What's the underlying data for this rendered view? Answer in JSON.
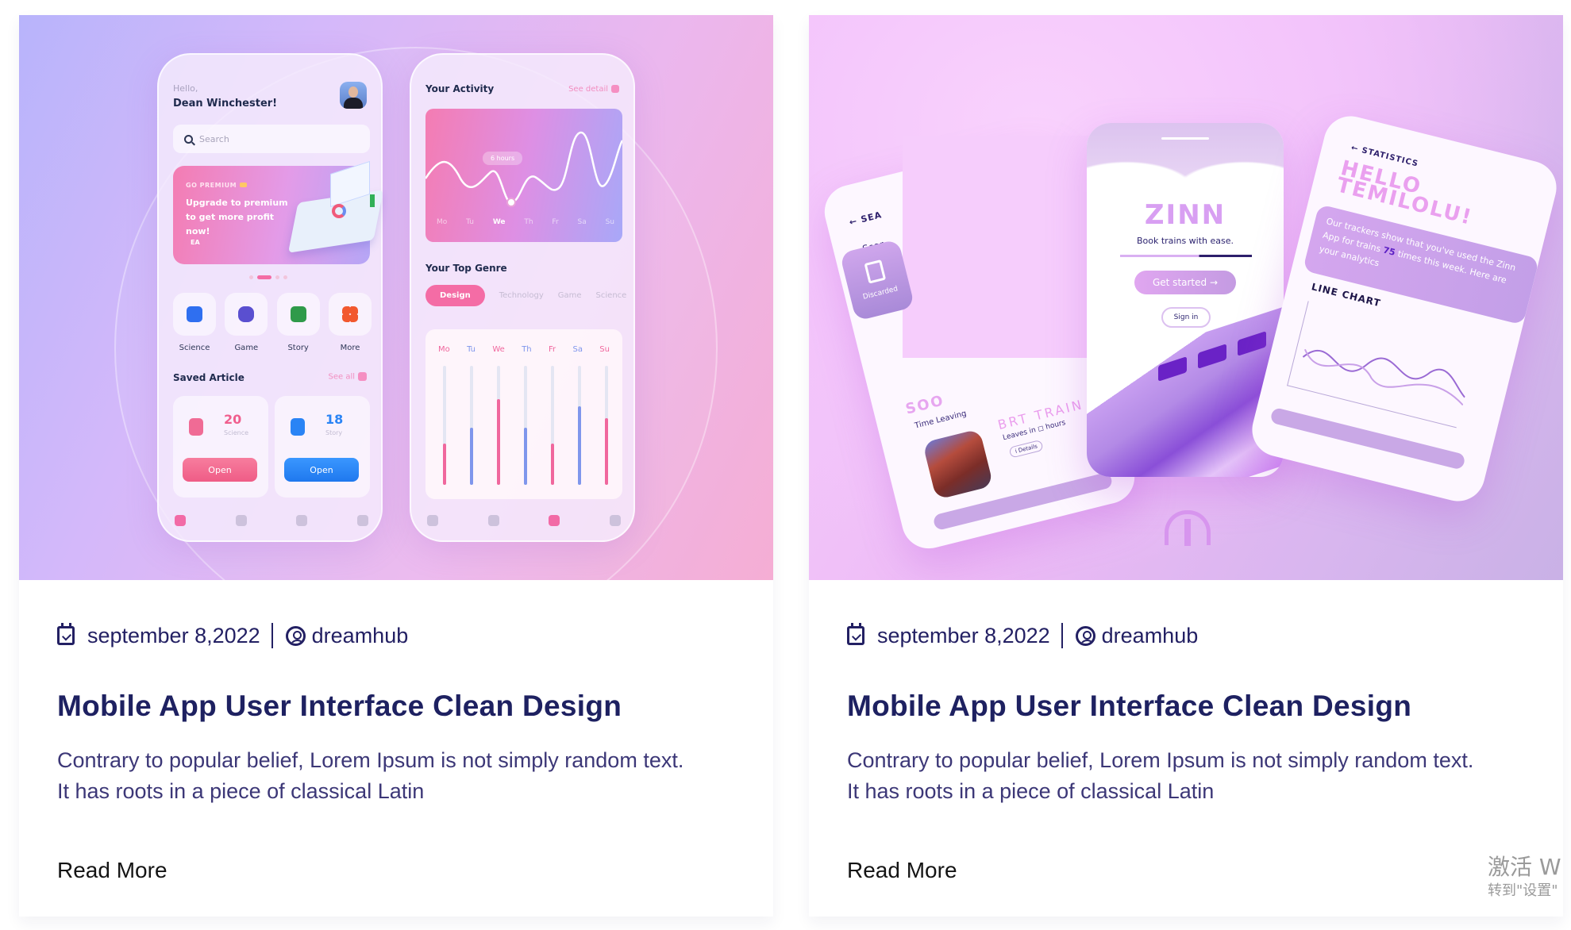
{
  "posts": [
    {
      "date": "september 8,2022",
      "author": "dreamhub",
      "title": "Mobile App User Interface Clean Design",
      "excerpt_line1": "Contrary to popular belief, Lorem Ipsum is not simply random text.",
      "excerpt_line2": "It has roots in a piece of classical Latin",
      "read_more": "Read More",
      "thumbnail": {
        "greeting": "Hello,",
        "user_name": "Dean Winchester!",
        "search_placeholder": "Search",
        "promo_label": "GO PREMIUM",
        "promo_text": "Upgrade to premium to get more profit now!",
        "promo_brand": "EA",
        "categories": [
          {
            "name": "Science",
            "color": "#2f6ff0"
          },
          {
            "name": "Game",
            "color": "#5a4fd0"
          },
          {
            "name": "Story",
            "color": "#2f9a4a"
          },
          {
            "name": "More",
            "color": "#f2582e"
          }
        ],
        "saved_title": "Saved Article",
        "see_all": "See all",
        "saved": [
          {
            "count": "20",
            "label": "Science",
            "button": "Open",
            "color": "#f05f8e"
          },
          {
            "count": "18",
            "label": "Story",
            "button": "Open",
            "color": "#2a84f5"
          }
        ],
        "activity_title": "Your Activity",
        "see_detail": "See detail",
        "activity_tooltip": "6 hours",
        "activity_days": [
          "Mo",
          "Tu",
          "We",
          "Th",
          "Fr",
          "Sa",
          "Su"
        ],
        "activity_selected_day": "We",
        "genre_title": "Your Top Genre",
        "genres": [
          "Design",
          "Technology",
          "Game",
          "Science"
        ],
        "genre_selected": "Design",
        "weekly": [
          {
            "day": "Mo",
            "value": 0.35,
            "color": "#f0679d"
          },
          {
            "day": "Tu",
            "value": 0.48,
            "color": "#7f96ec"
          },
          {
            "day": "We",
            "value": 0.72,
            "color": "#f0679d"
          },
          {
            "day": "Th",
            "value": 0.48,
            "color": "#7f96ec"
          },
          {
            "day": "Fr",
            "value": 0.35,
            "color": "#f0679d"
          },
          {
            "day": "Sa",
            "value": 0.66,
            "color": "#7f96ec"
          },
          {
            "day": "Su",
            "value": 0.56,
            "color": "#f0679d"
          }
        ]
      }
    },
    {
      "date": "september 8,2022",
      "author": "dreamhub",
      "title": "Mobile App User Interface Clean Design",
      "excerpt_line1": "Contrary to popular belief, Lorem Ipsum is not simply random text.",
      "excerpt_line2": "It has roots in a piece of classical Latin",
      "read_more": "Read More",
      "thumbnail": {
        "left_header": "SEA",
        "left_search": "Sear",
        "discarded": "Discarded",
        "soon": "SOO",
        "time_leaving": "Time Leaving",
        "train_name": "BRT TRAIN",
        "leaves_in": "Leaves in ◻ hours",
        "details": "i Details",
        "logo": "ZINN",
        "tagline": "Book trains with ease.",
        "get_started": "Get started →",
        "sign_in": "Sign in",
        "stats_header": "← STATISTICS",
        "greeting": "HELLO TEMILOLU!",
        "message_pre": "Our trackers show that you've used the Zinn App for trains",
        "message_count": "75",
        "message_post": "times this week. Here are your analytics",
        "chart_label": "LINE CHART"
      }
    }
  ],
  "watermark": {
    "line1": "激活 W",
    "line2": "转到\"设置\""
  }
}
